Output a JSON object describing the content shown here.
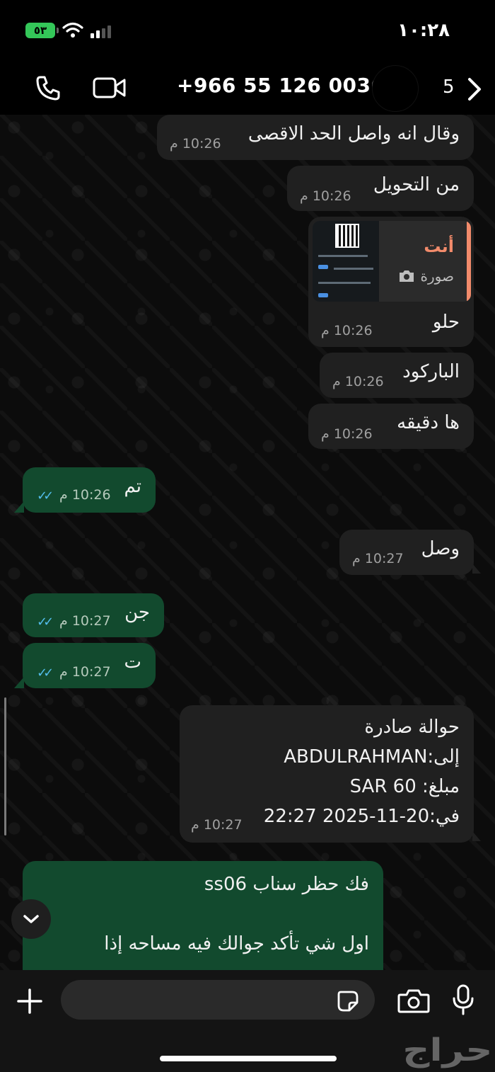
{
  "status_bar": {
    "battery": "٥٣",
    "time": "١٠:٢٨"
  },
  "header": {
    "contact": "+966 55 126 0036",
    "unread_count": "5"
  },
  "messages": [
    {
      "text": "وقال انه واصل الحد الاقصى",
      "time": "10:26 م"
    },
    {
      "text": "من التحويل",
      "time": "10:26 م"
    },
    {
      "reply_sender": "أنت",
      "reply_type": "صورة",
      "text": "حلو",
      "time": "10:26 م"
    },
    {
      "text": "الباركود",
      "time": "10:26 م"
    },
    {
      "text": "ها دقيقه",
      "time": "10:26 م"
    },
    {
      "text": "تم",
      "time": "10:26 م"
    },
    {
      "text": "وصل",
      "time": "10:27 م"
    },
    {
      "text": "جن",
      "time": "10:27 م"
    },
    {
      "text": "ت",
      "time": "10:27 م"
    },
    {
      "lines": [
        "حوالة صادرة",
        "إلى:ABDULRAHMAN",
        "مبلغ: SAR 60",
        "في:20-11-2025 22:27"
      ],
      "time": "10:27 م"
    },
    {
      "lines": [
        "فك حظر سناب ss06",
        "اول  شي    تأكد جوالك فيه مساحه إذا"
      ]
    }
  ],
  "watermark": "حراج",
  "icons": [
    "phone-icon",
    "video-icon",
    "back-chevron-icon",
    "read-ticks-icon",
    "camera-icon",
    "plus-icon",
    "sticker-icon",
    "mic-icon",
    "chevron-down-icon"
  ],
  "colors": {
    "outgoing": "#124a2e",
    "incoming": "#202020",
    "reply_accent": "#f28b6b",
    "read_ticks": "#53bdeb"
  }
}
